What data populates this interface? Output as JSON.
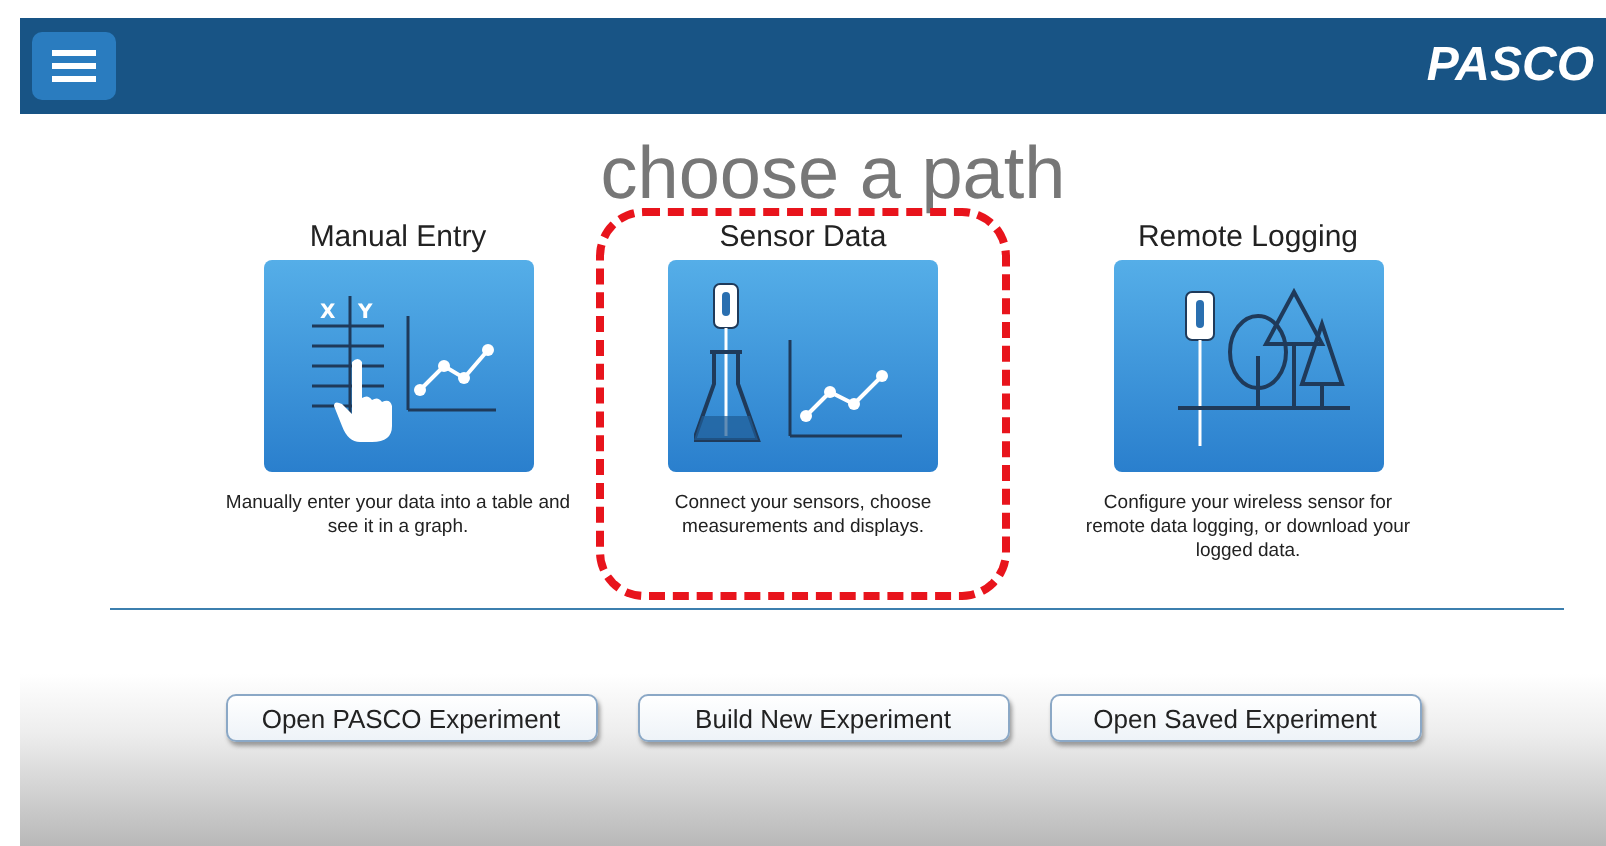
{
  "header": {
    "logo": "PASCO"
  },
  "title": "choose a path",
  "paths": [
    {
      "kind": "manual",
      "label": "Manual Entry",
      "description": "Manually enter your data into a table and see it in a graph.",
      "highlighted": false,
      "axis_x": "X",
      "axis_y": "Y"
    },
    {
      "kind": "sensor",
      "label": "Sensor Data",
      "description": "Connect your sensors, choose measurements and displays.",
      "highlighted": true
    },
    {
      "kind": "remote",
      "label": "Remote Logging",
      "description": "Configure your wireless sensor for remote data logging, or download your logged data.",
      "highlighted": false
    }
  ],
  "buttons": [
    "Open PASCO Experiment",
    "Build New Experiment",
    "Open Saved Experiment"
  ]
}
